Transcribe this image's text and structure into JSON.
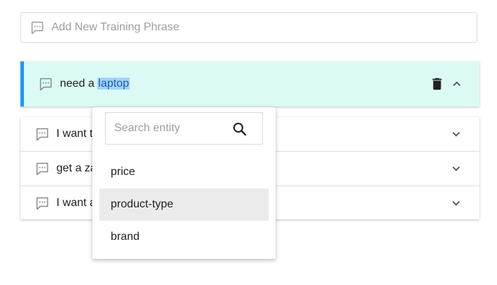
{
  "add_phrase": {
    "placeholder": "Add New Training Phrase",
    "icon": "comment-icon"
  },
  "active_phrase": {
    "text_prefix": "need a ",
    "highlighted": "laptop",
    "icons": {
      "message": "comment-icon",
      "delete": "trash-icon",
      "collapse": "chevron-up-icon"
    },
    "accent_color": "#1e9bff",
    "background_color": "#dcfaf4"
  },
  "phrases": [
    {
      "text": "I want t"
    },
    {
      "text": "get a za"
    },
    {
      "text": "I want a"
    }
  ],
  "entity_dropdown": {
    "search_placeholder": "Search entity",
    "options": [
      {
        "label": "price",
        "selected": false
      },
      {
        "label": "product-type",
        "selected": true
      },
      {
        "label": "brand",
        "selected": false
      }
    ]
  }
}
